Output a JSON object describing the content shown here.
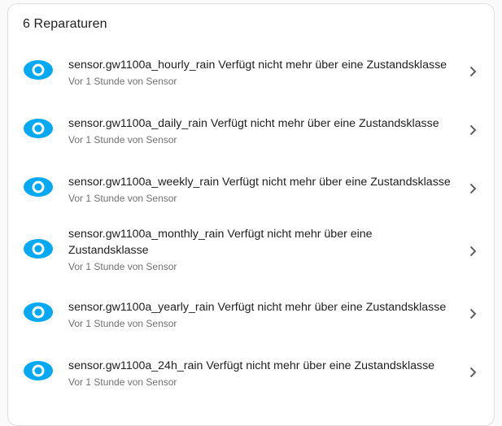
{
  "card": {
    "title": "6 Reparaturen"
  },
  "items": [
    {
      "title": "sensor.gw1100a_hourly_rain Verfügt nicht mehr über eine Zustandsklasse",
      "subtitle": "Vor 1 Stunde von Sensor",
      "icon": "eye-icon"
    },
    {
      "title": "sensor.gw1100a_daily_rain Verfügt nicht mehr über eine Zustandsklasse",
      "subtitle": "Vor 1 Stunde von Sensor",
      "icon": "eye-icon"
    },
    {
      "title": "sensor.gw1100a_weekly_rain Verfügt nicht mehr über eine Zustandsklasse",
      "subtitle": "Vor 1 Stunde von Sensor",
      "icon": "eye-icon"
    },
    {
      "title": "sensor.gw1100a_monthly_rain Verfügt nicht mehr über eine Zustandsklasse",
      "subtitle": "Vor 1 Stunde von Sensor",
      "icon": "eye-icon"
    },
    {
      "title": "sensor.gw1100a_yearly_rain Verfügt nicht mehr über eine Zustandsklasse",
      "subtitle": "Vor 1 Stunde von Sensor",
      "icon": "eye-icon"
    },
    {
      "title": "sensor.gw1100a_24h_rain Verfügt nicht mehr über eine Zustandsklasse",
      "subtitle": "Vor 1 Stunde von Sensor",
      "icon": "eye-icon"
    }
  ],
  "colors": {
    "accent": "#03a9f4",
    "chevron": "#616161",
    "secondary_text": "#727272"
  }
}
